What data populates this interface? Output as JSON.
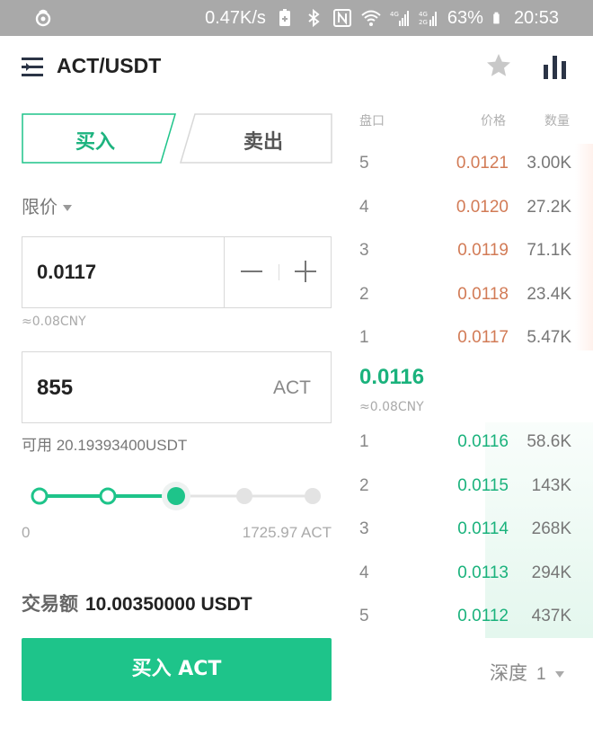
{
  "status_bar": {
    "speed": "0.47K/s",
    "battery": "63%",
    "time": "20:53",
    "icons": [
      "app-notification-icon",
      "battery-saver-icon",
      "bluetooth-icon",
      "nfc-icon",
      "wifi-icon",
      "signal-4g-icon",
      "signal-4g-2g-icon",
      "battery-icon"
    ]
  },
  "header": {
    "title": "ACT/USDT",
    "icons": [
      "menu-icon",
      "star-icon",
      "chart-icon"
    ]
  },
  "tabs": {
    "buy": "买入",
    "sell": "卖出"
  },
  "order_type": "限价",
  "price_input": {
    "value": "0.0117",
    "cny": "≈0.08CNY"
  },
  "amount_input": {
    "value": "855",
    "unit": "ACT"
  },
  "available": "可用 20.19393400USDT",
  "slider": {
    "min_label": "0",
    "max_label": "1725.97 ACT",
    "level_percent": 50,
    "steps": 5
  },
  "total": {
    "label": "交易额",
    "value": "10.00350000 USDT"
  },
  "buy_button": "买入 ACT",
  "order_book": {
    "headers": {
      "depth": "盘口",
      "price": "价格",
      "qty": "数量"
    },
    "asks": [
      {
        "idx": "5",
        "price": "0.0121",
        "qty": "3.00K"
      },
      {
        "idx": "4",
        "price": "0.0120",
        "qty": "27.2K"
      },
      {
        "idx": "3",
        "price": "0.0119",
        "qty": "71.1K"
      },
      {
        "idx": "2",
        "price": "0.0118",
        "qty": "23.4K"
      },
      {
        "idx": "1",
        "price": "0.0117",
        "qty": "5.47K"
      }
    ],
    "last_price": "0.0116",
    "last_cny": "≈0.08CNY",
    "bids": [
      {
        "idx": "1",
        "price": "0.0116",
        "qty": "58.6K"
      },
      {
        "idx": "2",
        "price": "0.0115",
        "qty": "143K"
      },
      {
        "idx": "3",
        "price": "0.0114",
        "qty": "268K"
      },
      {
        "idx": "4",
        "price": "0.0113",
        "qty": "294K"
      },
      {
        "idx": "5",
        "price": "0.0112",
        "qty": "437K"
      }
    ],
    "depth_label": "深度",
    "depth_value": "1"
  },
  "colors": {
    "accent_green": "#1ec48a",
    "bid_green": "#1ab27c",
    "ask_orange": "#d27b56"
  }
}
